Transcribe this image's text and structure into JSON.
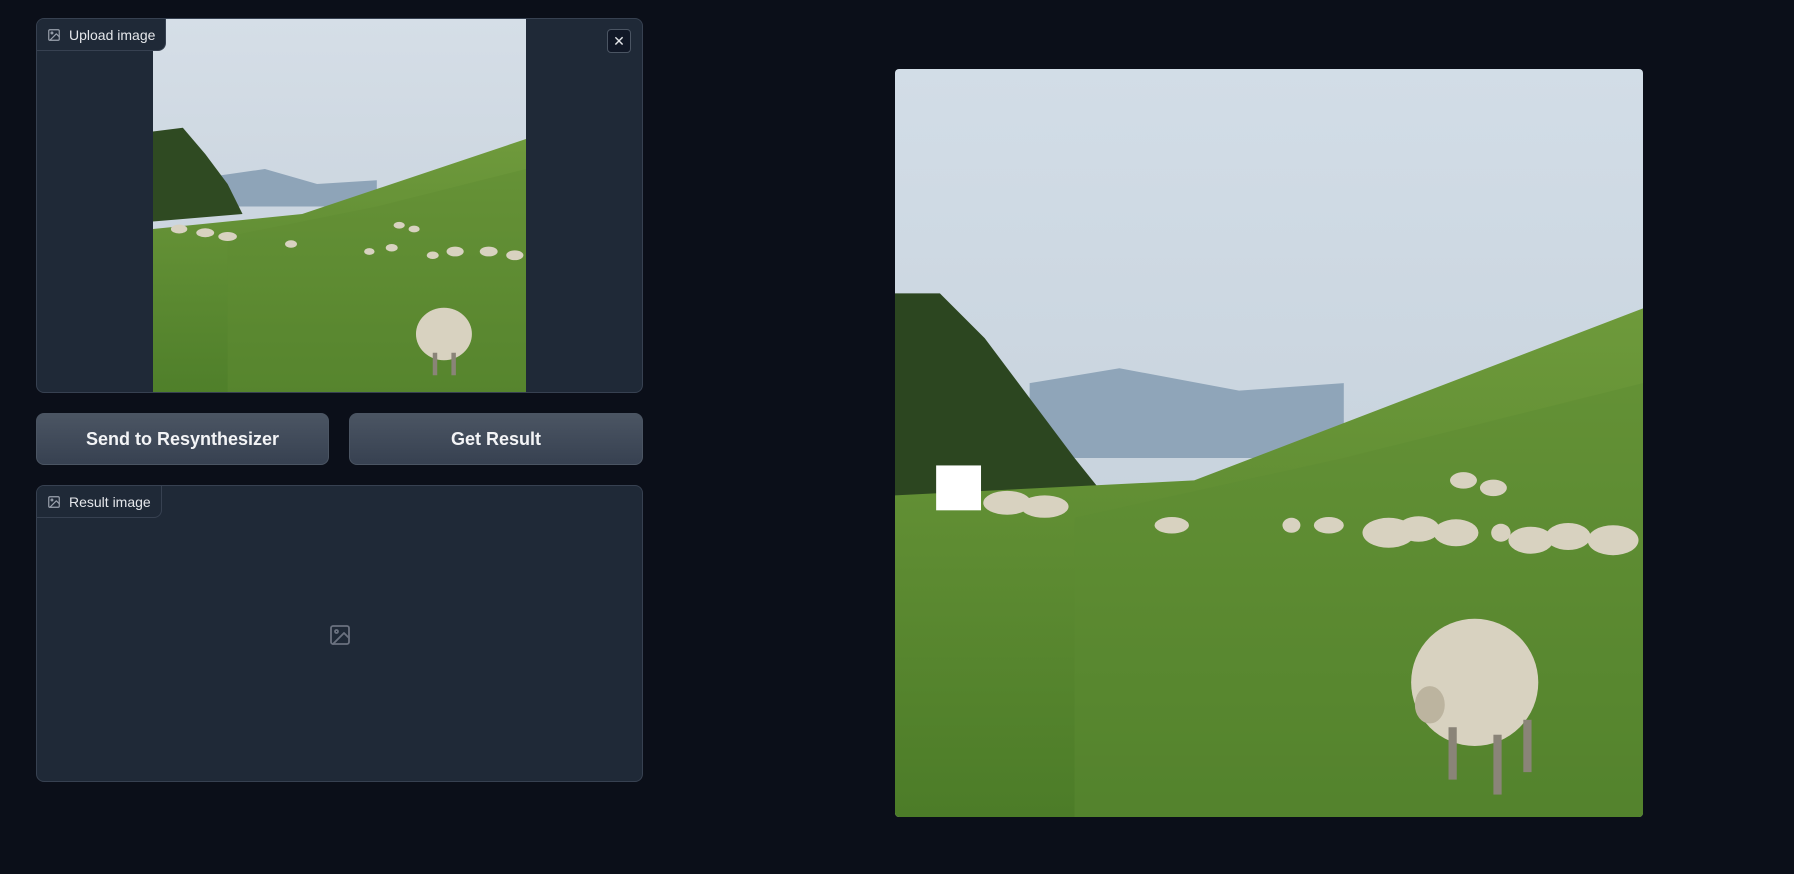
{
  "upload": {
    "label": "Upload image",
    "label_icon": "image-icon",
    "close_icon": "close-icon",
    "close_glyph": "✕"
  },
  "buttons": {
    "send_label": "Send to Resynthesizer",
    "get_label": "Get Result"
  },
  "result": {
    "label": "Result image",
    "label_icon": "image-icon",
    "empty_icon": "image-placeholder-icon"
  },
  "colors": {
    "background": "#0b0f19",
    "panel": "#1f2937",
    "border": "#374151",
    "button": "#4b5563"
  }
}
